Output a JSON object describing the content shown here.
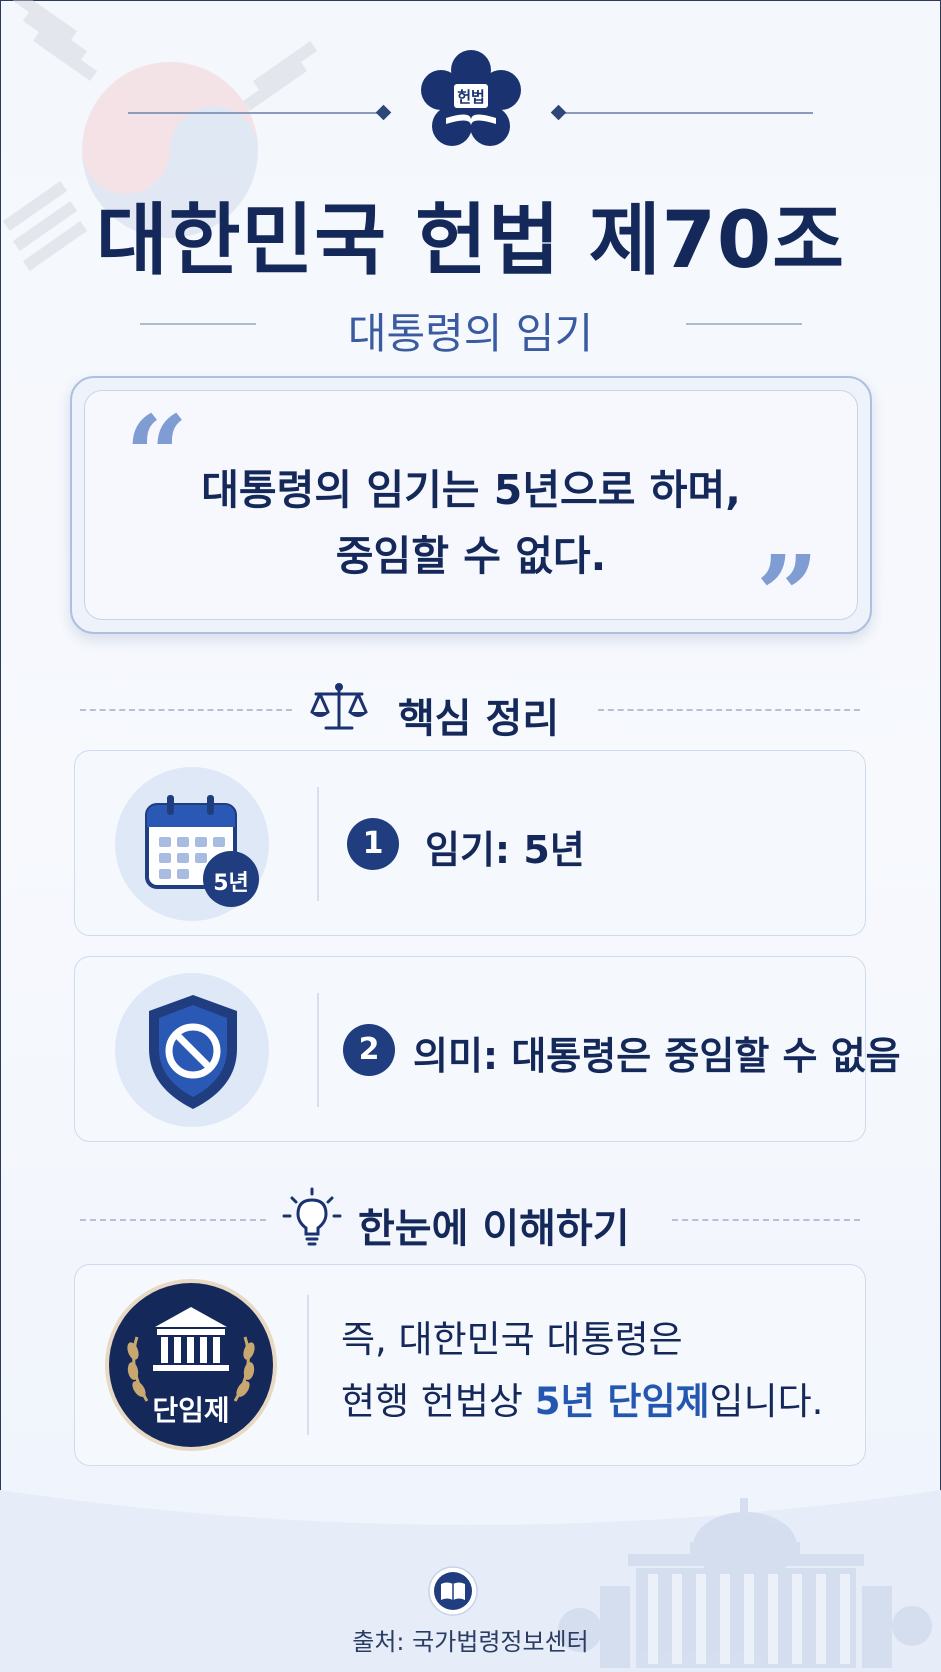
{
  "header": {
    "emblem_text": "헌법",
    "title": "대한민국 헌법 제70조",
    "subtitle": "대통령의 임기"
  },
  "quote": {
    "line1": "대통령의 임기는 5년으로 하며,",
    "line2": "중임할 수 없다."
  },
  "key_points": {
    "heading": "핵심 정리",
    "items": [
      {
        "number": "1",
        "text": "임기: 5년",
        "icon_badge": "5년",
        "icon": "calendar-icon"
      },
      {
        "number": "2",
        "text": "의미: 대통령은 중임할 수 없음",
        "icon": "prohibited-shield-icon"
      }
    ]
  },
  "summary": {
    "heading": "한눈에 이해하기",
    "badge_label": "단임제",
    "line1": "즉, 대한민국 대통령은",
    "line2_before": "현행 헌법상 ",
    "line2_highlight": "5년 단임제",
    "line2_after": "입니다."
  },
  "footer": {
    "source": "출처: 국가법령정보센터"
  },
  "colors": {
    "navy": "#14285a",
    "accent_blue": "#2457b0",
    "badge_navy": "#1f3d7f",
    "subtitle_blue": "#3a5ba0"
  }
}
